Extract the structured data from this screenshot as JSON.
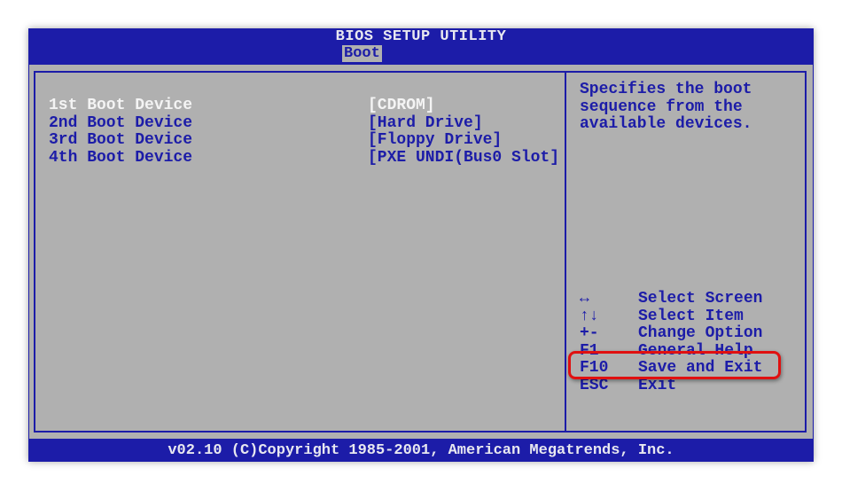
{
  "header": {
    "title": "BIOS SETUP UTILITY",
    "active_tab": "Boot"
  },
  "boot_devices": [
    {
      "label": "1st Boot Device",
      "value": "[CDROM]",
      "selected": true
    },
    {
      "label": "2nd Boot Device",
      "value": "[Hard Drive]",
      "selected": false
    },
    {
      "label": "3rd Boot Device",
      "value": "[Floppy Drive]",
      "selected": false
    },
    {
      "label": "4th Boot Device",
      "value": "[PXE UNDI(Bus0 Slot]",
      "selected": false
    }
  ],
  "help_text": "Specifies the boot\nsequence from the\navailable devices.",
  "keys": [
    {
      "key": "↔",
      "desc": "Select Screen"
    },
    {
      "key": "↑↓",
      "desc": "Select Item"
    },
    {
      "key": "+-",
      "desc": "Change Option"
    },
    {
      "key": "F1",
      "desc": "General Help"
    },
    {
      "key": "F10",
      "desc": "Save and Exit"
    },
    {
      "key": "ESC",
      "desc": "Exit"
    }
  ],
  "footer": "v02.10 (C)Copyright 1985-2001, American Megatrends, Inc.",
  "colors": {
    "background": "#1c1ca8",
    "panel": "#b0b0b0",
    "highlight": "#e01010"
  }
}
